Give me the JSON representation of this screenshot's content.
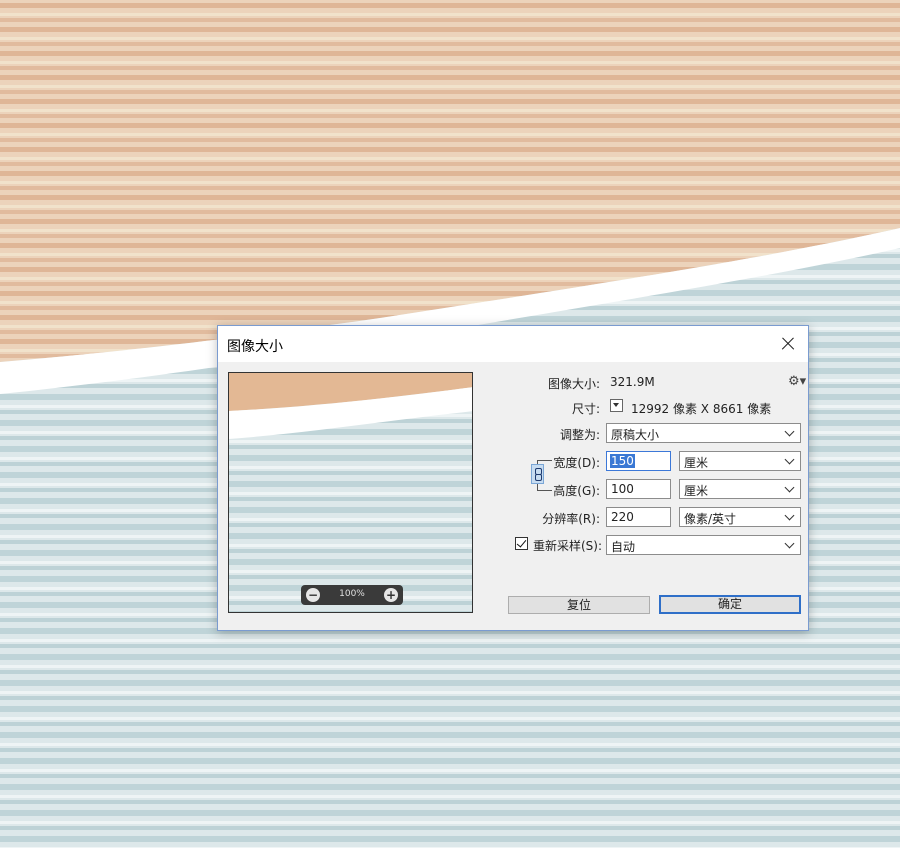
{
  "dialog": {
    "title": "图像大小",
    "image_size_label": "图像大小:",
    "image_size_value": "321.9M",
    "dimensions_label": "尺寸:",
    "dimensions_value": "12992 像素  X  8661 像素",
    "fit_to_label": "调整为:",
    "fit_to_value": "原稿大小",
    "width_label": "宽度(D):",
    "width_value": "150",
    "width_unit": "厘米",
    "height_label": "高度(G):",
    "height_value": "100",
    "height_unit": "厘米",
    "resolution_label": "分辨率(R):",
    "resolution_value": "220",
    "resolution_unit": "像素/英寸",
    "resample_label": "重新采样(S):",
    "resample_checked": true,
    "resample_value": "自动",
    "reset_button": "复位",
    "ok_button": "确定",
    "zoom_value": "100%"
  },
  "colors": {
    "accent": "#2f6fc8",
    "selection": "#3a78d4",
    "bg_top": "#e8c7a8",
    "bg_bottom": "#d7e4e6"
  },
  "icons": {
    "gear": "gear-icon",
    "close": "close-icon",
    "link": "link-icon",
    "zoom_out": "zoom-out-icon",
    "zoom_in": "zoom-in-icon"
  }
}
